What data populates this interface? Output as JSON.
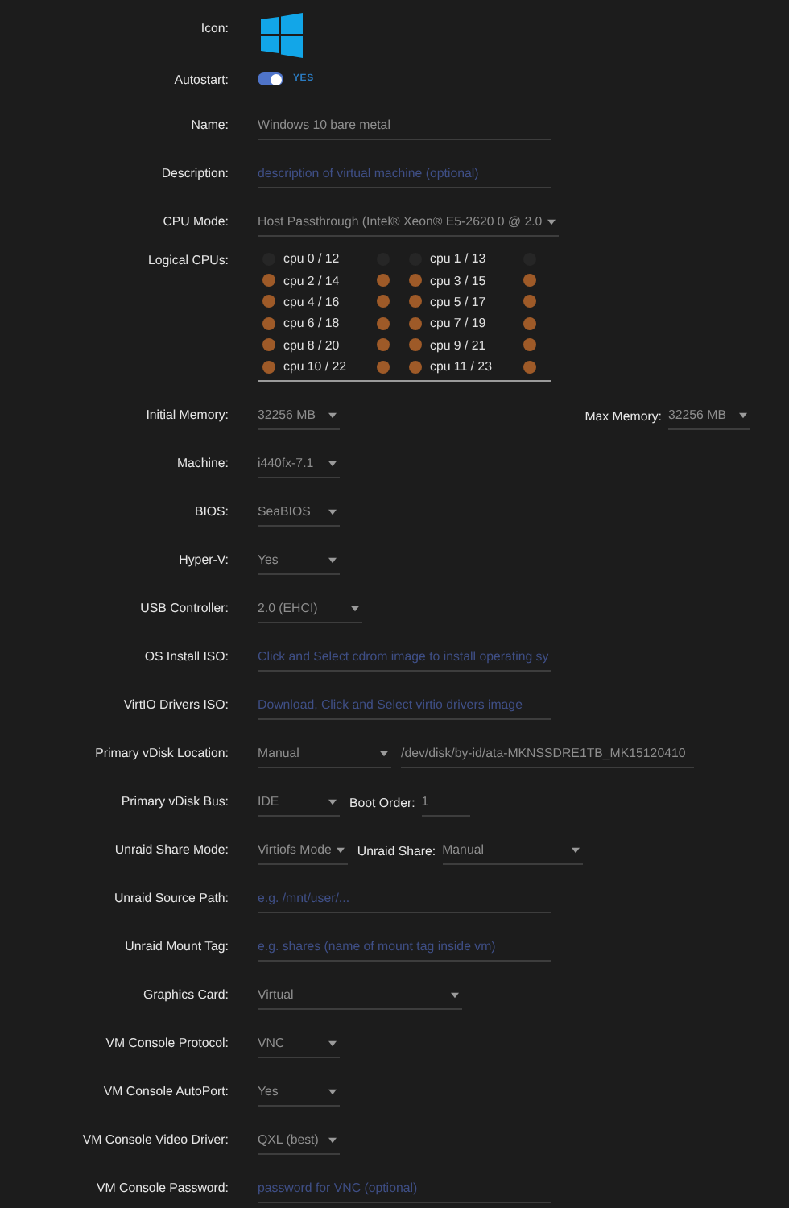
{
  "icon_row": {
    "label": "Icon:"
  },
  "autostart": {
    "label": "Autostart:",
    "on": true,
    "state_text": "YES"
  },
  "fields_top": [
    {
      "label": "Name:",
      "kind": "text",
      "value": "Windows 10 bare metal"
    },
    {
      "label": "Description:",
      "kind": "text",
      "placeholder": "description of virtual machine (optional)"
    },
    {
      "label": "CPU Mode:",
      "kind": "select",
      "value": "Host Passthrough (Intel® Xeon® E5-2620 0 @ 2.0"
    }
  ],
  "logical_cpus": {
    "label": "Logical CPUs:",
    "cpus": [
      {
        "label": "cpu 0 / 12",
        "checked_left": false,
        "checked_right": false
      },
      {
        "label": "cpu 1 / 13",
        "checked_left": false,
        "checked_right": false
      },
      {
        "label": "cpu 2 / 14",
        "checked_left": true,
        "checked_right": true
      },
      {
        "label": "cpu 3 / 15",
        "checked_left": true,
        "checked_right": true
      },
      {
        "label": "cpu 4 / 16",
        "checked_left": true,
        "checked_right": true
      },
      {
        "label": "cpu 5 / 17",
        "checked_left": true,
        "checked_right": true
      },
      {
        "label": "cpu 6 / 18",
        "checked_left": true,
        "checked_right": true
      },
      {
        "label": "cpu 7 / 19",
        "checked_left": true,
        "checked_right": true
      },
      {
        "label": "cpu 8 / 20",
        "checked_left": true,
        "checked_right": true
      },
      {
        "label": "cpu 9 / 21",
        "checked_left": true,
        "checked_right": true
      },
      {
        "label": "cpu 10 / 22",
        "checked_left": true,
        "checked_right": true
      },
      {
        "label": "cpu 11 / 23",
        "checked_left": true,
        "checked_right": true
      }
    ]
  },
  "fields": [
    {
      "label": "Initial Memory:",
      "kind": "select",
      "value": "32256 MB",
      "extras": [
        {
          "label": "Max Memory:",
          "kind": "select",
          "value": "32256 MB"
        }
      ]
    },
    {
      "label": "Machine:",
      "kind": "select",
      "value": "i440fx-7.1"
    },
    {
      "label": "BIOS:",
      "kind": "select",
      "value": "SeaBIOS"
    },
    {
      "label": "Hyper-V:",
      "kind": "select",
      "value": "Yes"
    },
    {
      "label": "USB Controller:",
      "kind": "select",
      "value": "2.0 (EHCI)"
    },
    {
      "label": "OS Install ISO:",
      "kind": "text",
      "placeholder": "Click and Select cdrom image to install operating sy"
    },
    {
      "label": "VirtIO Drivers ISO:",
      "kind": "text",
      "placeholder": "Download, Click and Select virtio drivers image"
    },
    {
      "label": "Primary vDisk Location:",
      "kind": "select",
      "value": "Manual",
      "extras": [
        {
          "kind": "text",
          "value": "/dev/disk/by-id/ata-MKNSSDRE1TB_MK15120410"
        }
      ]
    },
    {
      "label": "Primary vDisk Bus:",
      "kind": "select",
      "value": "IDE",
      "extras": [
        {
          "label": "Boot Order:",
          "kind": "text",
          "value": "1"
        }
      ]
    },
    {
      "label": "Unraid Share Mode:",
      "kind": "select",
      "value": "Virtiofs Mode",
      "extras": [
        {
          "label": "Unraid Share:",
          "kind": "select",
          "value": "Manual"
        }
      ]
    },
    {
      "label": "Unraid Source Path:",
      "kind": "text",
      "placeholder": "e.g. /mnt/user/..."
    },
    {
      "label": "Unraid Mount Tag:",
      "kind": "text",
      "placeholder": "e.g. shares (name of mount tag inside vm)"
    },
    {
      "label": "Graphics Card:",
      "kind": "select",
      "value": "Virtual"
    },
    {
      "label": "VM Console Protocol:",
      "kind": "select",
      "value": "VNC"
    },
    {
      "label": "VM Console AutoPort:",
      "kind": "select",
      "value": "Yes"
    },
    {
      "label": "VM Console Video Driver:",
      "kind": "select",
      "value": "QXL (best)"
    },
    {
      "label": "VM Console Password:",
      "kind": "text",
      "placeholder": "password for VNC (optional)"
    }
  ]
}
